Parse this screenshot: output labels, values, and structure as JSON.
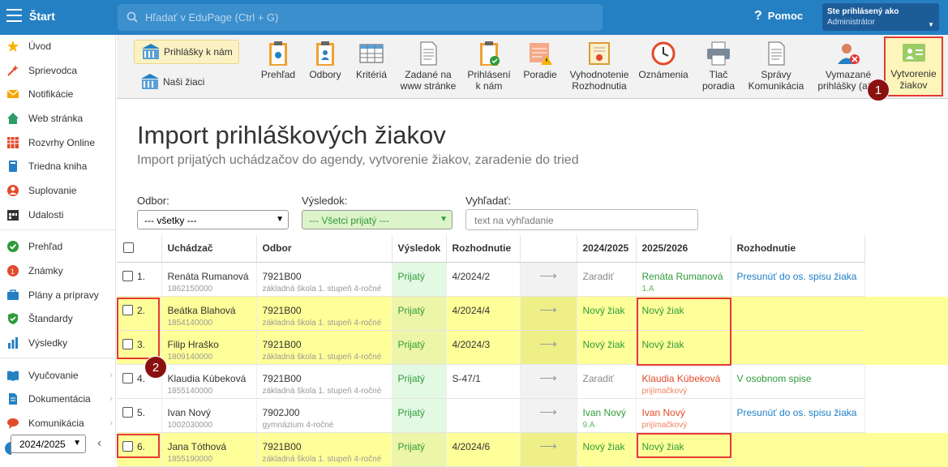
{
  "topbar": {
    "title": "Štart",
    "search_placeholder": "Hľadať v EduPage (Ctrl + G)",
    "help": "Pomoc",
    "user_label": "Ste prihlásený ako",
    "user_name": "Administrátor"
  },
  "sidebar": {
    "items": [
      {
        "label": "Úvod",
        "icon": "star-icon"
      },
      {
        "label": "Sprievodca",
        "icon": "sparkle-icon"
      },
      {
        "label": "Notifikácie",
        "icon": "envelope-icon"
      },
      {
        "label": "Web stránka",
        "icon": "house-icon"
      },
      {
        "label": "Rozvrhy Online",
        "icon": "timetable-icon"
      },
      {
        "label": "Triedna kniha",
        "icon": "book-icon"
      },
      {
        "label": "Suplovanie",
        "icon": "substitute-icon"
      },
      {
        "label": "Udalosti",
        "icon": "calendar-icon"
      },
      {
        "label": "Prehľad",
        "icon": "check-circle-icon"
      },
      {
        "label": "Známky",
        "icon": "grades-icon"
      },
      {
        "label": "Plány a prípravy",
        "icon": "briefcase-icon"
      },
      {
        "label": "Štandardy",
        "icon": "shield-check-icon"
      },
      {
        "label": "Výsledky",
        "icon": "bar-chart-icon"
      },
      {
        "label": "Vyučovanie",
        "icon": "open-book-icon"
      },
      {
        "label": "Dokumentácia",
        "icon": "document-icon"
      },
      {
        "label": "Komunikácia",
        "icon": "chat-icon"
      }
    ],
    "year": "2024/2025"
  },
  "toolbar": {
    "tab1": "Prihlášky k nám",
    "tab2": "Naši žiaci",
    "buttons": [
      {
        "label": "Prehľad",
        "label2": ""
      },
      {
        "label": "Odbory",
        "label2": ""
      },
      {
        "label": "Kritériá",
        "label2": ""
      },
      {
        "label": "Zadané na",
        "label2": "www stránke"
      },
      {
        "label": "Prihlásení",
        "label2": "k nám"
      },
      {
        "label": "Poradie",
        "label2": ""
      },
      {
        "label": "Vyhodnotenie",
        "label2": "Rozhodnutia"
      },
      {
        "label": "Oznámenia",
        "label2": ""
      },
      {
        "label": "Tlač",
        "label2": "poradia"
      },
      {
        "label": "Správy",
        "label2": "Komunikácia"
      },
      {
        "label": "Vymazané",
        "label2": "prihlášky (aSc"
      },
      {
        "label": "Vytvorenie",
        "label2": "žiakov"
      }
    ]
  },
  "badges": {
    "b1": "1",
    "b2": "2"
  },
  "page": {
    "title": "Import prihláškových žiakov",
    "subtitle": "Import prijatých uchádzačov do agendy, vytvorenie žiakov, zaradenie do tried"
  },
  "filters": {
    "odbor_label": "Odbor:",
    "odbor_value": "--- všetky ---",
    "vysledok_label": "Výsledok:",
    "vysledok_value": "--- Všetci prijatý ---",
    "search_label": "Vyhľadať:",
    "search_placeholder": "text na vyhľadanie"
  },
  "table": {
    "headers": [
      "Uchádzač",
      "Odbor",
      "Výsledok",
      "Rozhodnutie",
      "2024/2025",
      "2025/2026",
      "Rozhodnutie"
    ],
    "rows": [
      {
        "num": "1.",
        "name": "Renáta Rumanová",
        "id": "1862150000",
        "odbor": "7921B00",
        "odbor_desc": "základná škola 1. stupeň 4-ročné",
        "vysledok": "Prijatý",
        "rozh": "4/2024/2",
        "y1": "Zaradiť",
        "y2": "Renáta Rumanová",
        "y2sub": "1.A",
        "rozh2": "Presunúť do os. spisu žiaka"
      },
      {
        "num": "2.",
        "name": "Beátka Blahová",
        "id": "1854140000",
        "odbor": "7921B00",
        "odbor_desc": "základná škola 1. stupeň 4-ročné",
        "vysledok": "Prijatý",
        "rozh": "4/2024/4",
        "y1": "Nový žiak",
        "y2": "Nový žiak",
        "y2sub": "",
        "rozh2": ""
      },
      {
        "num": "3.",
        "name": "Filip Hraško",
        "id": "1809140000",
        "odbor": "7921B00",
        "odbor_desc": "základná škola 1. stupeň 4-ročné",
        "vysledok": "Prijatý",
        "rozh": "4/2024/3",
        "y1": "Nový žiak",
        "y2": "Nový žiak",
        "y2sub": "",
        "rozh2": ""
      },
      {
        "num": "4.",
        "name": "Klaudia Kúbeková",
        "id": "1855140000",
        "odbor": "7921B00",
        "odbor_desc": "základná škola 1. stupeň 4-ročné",
        "vysledok": "Prijatý",
        "rozh": "S-47/1",
        "y1": "Zaradiť",
        "y2": "Klaudia Kúbeková",
        "y2sub": "prijímačkový",
        "rozh2": "V osobnom spise"
      },
      {
        "num": "5.",
        "name": "Ivan Nový",
        "id": "1002030000",
        "odbor": "7902J00",
        "odbor_desc": "gymnázium 4-ročné",
        "vysledok": "Prijatý",
        "rozh": "",
        "y1": "Ivan Nový",
        "y1sub": "9.A",
        "y2": "Ivan Nový",
        "y2sub": "prijímačkový",
        "rozh2": "Presunúť do os. spisu žiaka"
      },
      {
        "num": "6.",
        "name": "Jana Tóthová",
        "id": "1855190000",
        "odbor": "7921B00",
        "odbor_desc": "základná škola 1. stupeň 4-ročné",
        "vysledok": "Prijatý",
        "rozh": "4/2024/6",
        "y1": "Nový žiak",
        "y2": "Nový žiak",
        "y2sub": "",
        "rozh2": ""
      }
    ]
  }
}
